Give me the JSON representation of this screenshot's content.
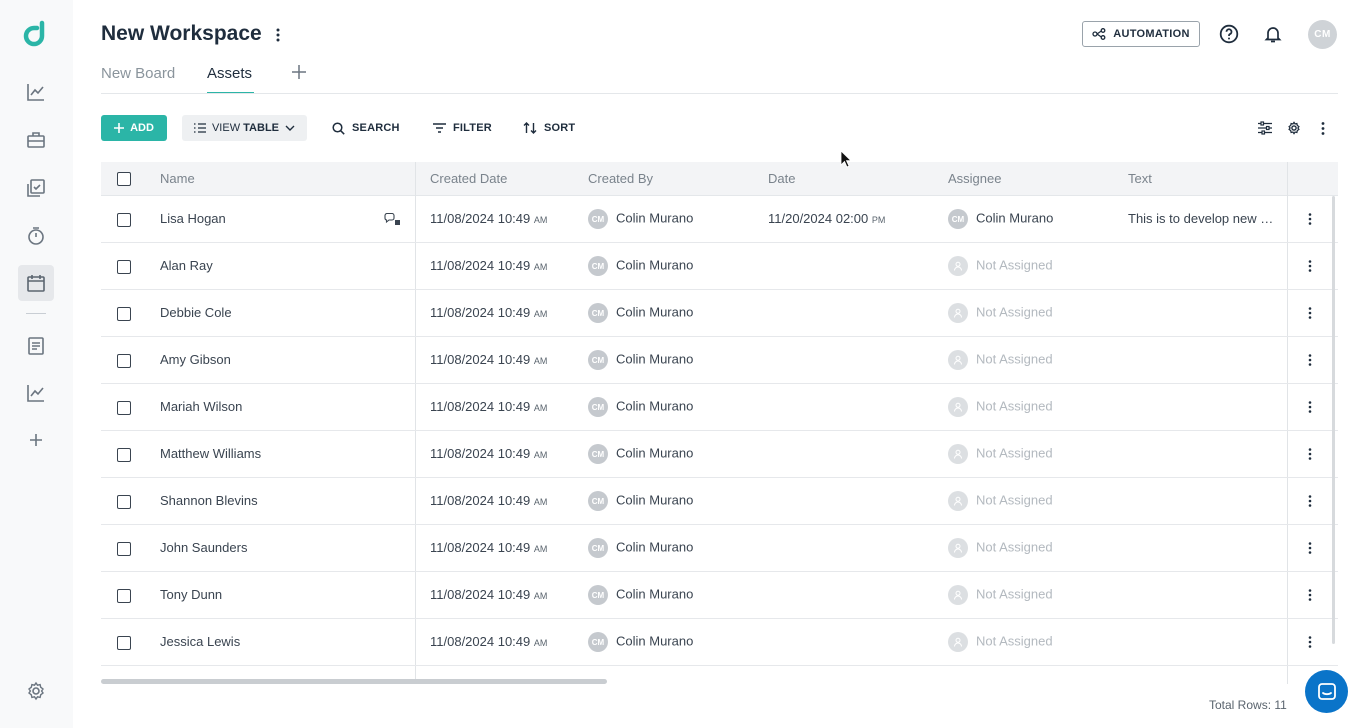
{
  "workspace": {
    "title": "New Workspace"
  },
  "tabs": [
    {
      "label": "New Board",
      "active": false
    },
    {
      "label": "Assets",
      "active": true
    }
  ],
  "header": {
    "automation_label": "AUTOMATION",
    "avatar_initials": "CM"
  },
  "toolbar": {
    "add_label": "ADD",
    "view_prefix": "VIEW",
    "view_label": "TABLE",
    "search_label": "SEARCH",
    "filter_label": "FILTER",
    "sort_label": "SORT"
  },
  "table": {
    "columns": [
      "Name",
      "Created Date",
      "Created By",
      "Date",
      "Assignee",
      "Text"
    ],
    "rows": [
      {
        "name": "Lisa Hogan",
        "created_date": "11/08/2024 10:49",
        "created_ampm": "AM",
        "created_by": "Colin Murano",
        "created_by_initials": "CM",
        "date": "11/20/2024 02:00",
        "date_ampm": "PM",
        "assignee": "Colin Murano",
        "assignee_initials": "CM",
        "text": "This is to develop new …"
      },
      {
        "name": "Alan Ray",
        "created_date": "11/08/2024 10:49",
        "created_ampm": "AM",
        "created_by": "Colin Murano",
        "created_by_initials": "CM",
        "date": "",
        "date_ampm": "",
        "assignee": "Not Assigned",
        "assignee_initials": "",
        "text": ""
      },
      {
        "name": "Debbie Cole",
        "created_date": "11/08/2024 10:49",
        "created_ampm": "AM",
        "created_by": "Colin Murano",
        "created_by_initials": "CM",
        "date": "",
        "date_ampm": "",
        "assignee": "Not Assigned",
        "assignee_initials": "",
        "text": ""
      },
      {
        "name": "Amy Gibson",
        "created_date": "11/08/2024 10:49",
        "created_ampm": "AM",
        "created_by": "Colin Murano",
        "created_by_initials": "CM",
        "date": "",
        "date_ampm": "",
        "assignee": "Not Assigned",
        "assignee_initials": "",
        "text": ""
      },
      {
        "name": "Mariah Wilson",
        "created_date": "11/08/2024 10:49",
        "created_ampm": "AM",
        "created_by": "Colin Murano",
        "created_by_initials": "CM",
        "date": "",
        "date_ampm": "",
        "assignee": "Not Assigned",
        "assignee_initials": "",
        "text": ""
      },
      {
        "name": "Matthew Williams",
        "created_date": "11/08/2024 10:49",
        "created_ampm": "AM",
        "created_by": "Colin Murano",
        "created_by_initials": "CM",
        "date": "",
        "date_ampm": "",
        "assignee": "Not Assigned",
        "assignee_initials": "",
        "text": ""
      },
      {
        "name": "Shannon Blevins",
        "created_date": "11/08/2024 10:49",
        "created_ampm": "AM",
        "created_by": "Colin Murano",
        "created_by_initials": "CM",
        "date": "",
        "date_ampm": "",
        "assignee": "Not Assigned",
        "assignee_initials": "",
        "text": ""
      },
      {
        "name": "John Saunders",
        "created_date": "11/08/2024 10:49",
        "created_ampm": "AM",
        "created_by": "Colin Murano",
        "created_by_initials": "CM",
        "date": "",
        "date_ampm": "",
        "assignee": "Not Assigned",
        "assignee_initials": "",
        "text": ""
      },
      {
        "name": "Tony Dunn",
        "created_date": "11/08/2024 10:49",
        "created_ampm": "AM",
        "created_by": "Colin Murano",
        "created_by_initials": "CM",
        "date": "",
        "date_ampm": "",
        "assignee": "Not Assigned",
        "assignee_initials": "",
        "text": ""
      },
      {
        "name": "Jessica Lewis",
        "created_date": "11/08/2024 10:49",
        "created_ampm": "AM",
        "created_by": "Colin Murano",
        "created_by_initials": "CM",
        "date": "",
        "date_ampm": "",
        "assignee": "Not Assigned",
        "assignee_initials": "",
        "text": ""
      }
    ]
  },
  "footer": {
    "total_rows": "Total Rows: 11"
  },
  "colors": {
    "accent": "#2bb5a7",
    "chat": "#0a74c9",
    "text_dark": "#1f2d3d"
  },
  "icons": {
    "sidebar": [
      "logo-icon",
      "chart-icon",
      "briefcase-icon",
      "checklist-icon",
      "timer-icon",
      "calendar-icon",
      "document-icon",
      "chart-icon",
      "plus-icon",
      "gear-icon"
    ]
  }
}
